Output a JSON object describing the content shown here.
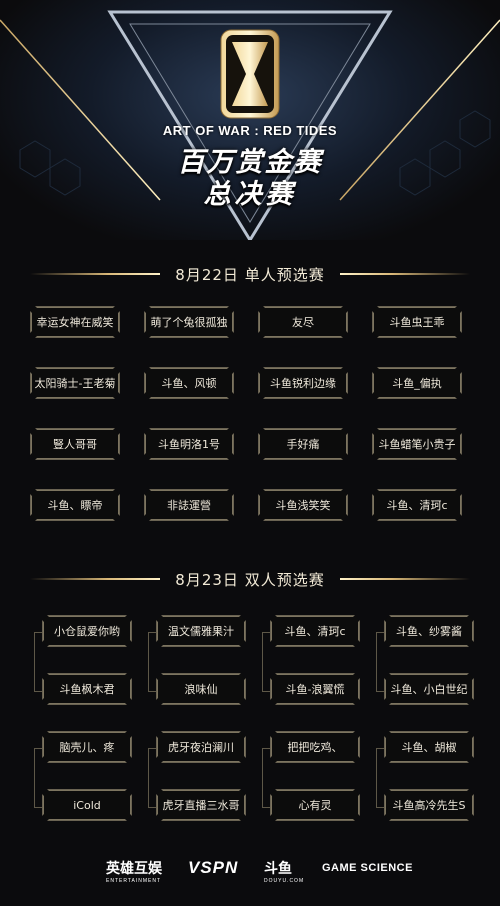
{
  "header": {
    "logo_text": "ART OF WAR : RED TIDES",
    "title_line1": "百万赏金赛",
    "title_line2": "总决赛"
  },
  "section_single": {
    "title": "8月22日 单人预选赛",
    "players": [
      "幸运女神在威笑",
      "萌了个兔很孤独",
      "友尽",
      "斗鱼虫王乖",
      "太阳骑士-王老菊",
      "斗鱼、风顿",
      "斗鱼锐利边缘",
      "斗鱼_偏执",
      "豎人哥哥",
      "斗鱼明洛1号",
      "手好痛",
      "斗鱼蜡笔小贵子",
      "斗鱼、瞟帝",
      "非誌運營",
      "斗鱼浅笑笑",
      "斗鱼、清珂c"
    ]
  },
  "section_duo": {
    "title": "8月23日 双人预选赛",
    "players": [
      "小仓鼠爱你哟",
      "温文儒雅果汁",
      "斗鱼、清珂c",
      "斗鱼、纱雾酱",
      "斗鱼枫木君",
      "浪味仙",
      "斗鱼-浪翼慌",
      "斗鱼、小白世纪",
      "脑壳儿、疼",
      "虎牙夜泊澜川",
      "把把吃鸡、",
      "斗鱼、胡椒",
      "iCold",
      "虎牙直播三水哥",
      "心有灵",
      "斗鱼高冷先生S"
    ]
  },
  "footer": {
    "sponsor1": "英雄互娱",
    "sponsor1_sub": "ENTERTAINMENT",
    "sponsor2": "VSPN",
    "sponsor3": "斗鱼",
    "sponsor3_sub": "DOUYU.COM",
    "sponsor4": "GAME SCIENCE"
  },
  "colors": {
    "gold": "#d9b878",
    "background": "#0b0b0d",
    "box_border": "#7d7560"
  }
}
